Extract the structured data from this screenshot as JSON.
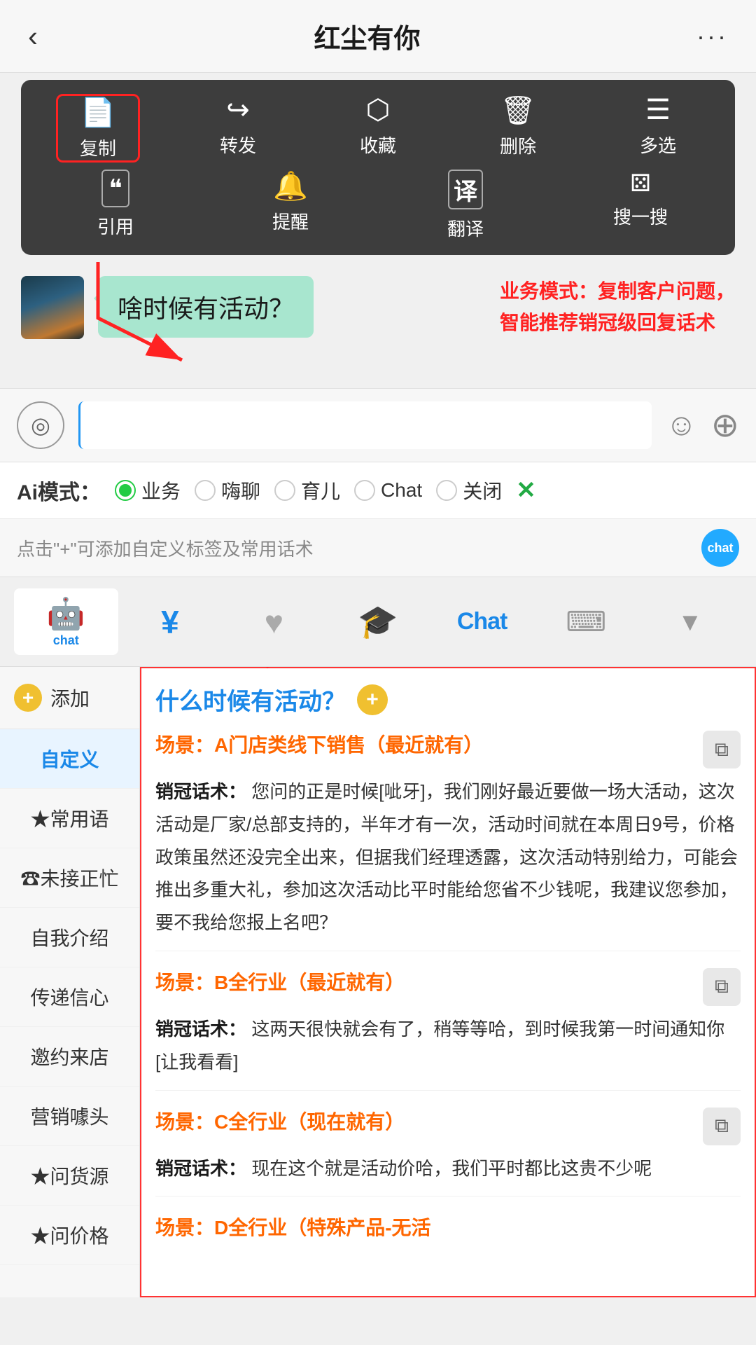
{
  "header": {
    "back_icon": "‹",
    "title": "红尘有你",
    "more_icon": "···"
  },
  "context_menu": {
    "row1": [
      {
        "icon": "📄",
        "label": "复制",
        "highlight": true
      },
      {
        "icon": "↪",
        "label": "转发",
        "highlight": false
      },
      {
        "icon": "⬡",
        "label": "收藏",
        "highlight": false
      },
      {
        "icon": "🗑",
        "label": "删除",
        "highlight": false
      },
      {
        "icon": "☰",
        "label": "多选",
        "highlight": false
      }
    ],
    "row2": [
      {
        "icon": "❝",
        "label": "引用",
        "highlight": false
      },
      {
        "icon": "🔔",
        "label": "提醒",
        "highlight": false
      },
      {
        "icon": "译",
        "label": "翻译",
        "highlight": false
      },
      {
        "icon": "∿",
        "label": "搜一搜",
        "highlight": false
      }
    ]
  },
  "annotation": {
    "bubble_text": "啥时候有活动？",
    "annotation_text": "业务模式：复制客户问题，\n智能推荐销冠级回复话术"
  },
  "ai_mode_bar": {
    "label": "Ai模式：",
    "options": [
      {
        "label": "业务",
        "active": true
      },
      {
        "label": "嗨聊",
        "active": false
      },
      {
        "label": "育儿",
        "active": false
      },
      {
        "label": "Chat",
        "active": false
      },
      {
        "label": "关闭",
        "active": false
      }
    ],
    "close_icon": "✕"
  },
  "hint_bar": {
    "text": "点击\"+\"可添加自定义标签及常用话术",
    "badge": "chat"
  },
  "toolbar": {
    "items": [
      {
        "symbol": "🤖",
        "label": "chat",
        "active": true
      },
      {
        "symbol": "¥",
        "label": "",
        "active": false
      },
      {
        "symbol": "♥",
        "label": "",
        "active": false
      },
      {
        "symbol": "🎓",
        "label": "",
        "active": false
      },
      {
        "symbol": "Chat",
        "label": "",
        "active": false
      },
      {
        "symbol": "⌨",
        "label": "",
        "active": false
      },
      {
        "symbol": "▼",
        "label": "",
        "active": false
      }
    ]
  },
  "sidebar": {
    "add_label": "添加",
    "items": [
      {
        "label": "自定义",
        "active": true
      },
      {
        "label": "★常用语",
        "active": false
      },
      {
        "label": "☎未接正忙",
        "active": false
      },
      {
        "label": "自我介绍",
        "active": false
      },
      {
        "label": "传递信心",
        "active": false
      },
      {
        "label": "邀约来店",
        "active": false
      },
      {
        "label": "营销噱头",
        "active": false
      },
      {
        "label": "★问货源",
        "active": false
      },
      {
        "label": "★问价格",
        "active": false
      }
    ]
  },
  "content": {
    "query": "什么时候有活动？",
    "scenes": [
      {
        "id": "A",
        "title": "场景：A门店类线下销售（最近就有）",
        "label": "销冠话术：",
        "text": "您问的正是时候[呲牙]，我们刚好最近要做一场大活动，这次活动是厂家/总部支持的，半年才有一次，活动时间就在本周日9号，价格政策虽然还没完全出来，但据我们经理透露，这次活动特别给力，可能会推出多重大礼，参加这次活动比平时能给您省不少钱呢，我建议您参加，要不我给您报上名吧？"
      },
      {
        "id": "B",
        "title": "场景：B全行业（最近就有）",
        "label": "销冠话术：",
        "text": "这两天很快就会有了，稍等等哈，到时候我第一时间通知你[让我看看]"
      },
      {
        "id": "C",
        "title": "场景：C全行业（现在就有）",
        "label": "销冠话术：",
        "text": "现在这个就是活动价哈，我们平时都比这贵不少呢"
      },
      {
        "id": "D",
        "title": "场景：D全行业（特殊产品-无活",
        "label": "",
        "text": ""
      }
    ]
  }
}
